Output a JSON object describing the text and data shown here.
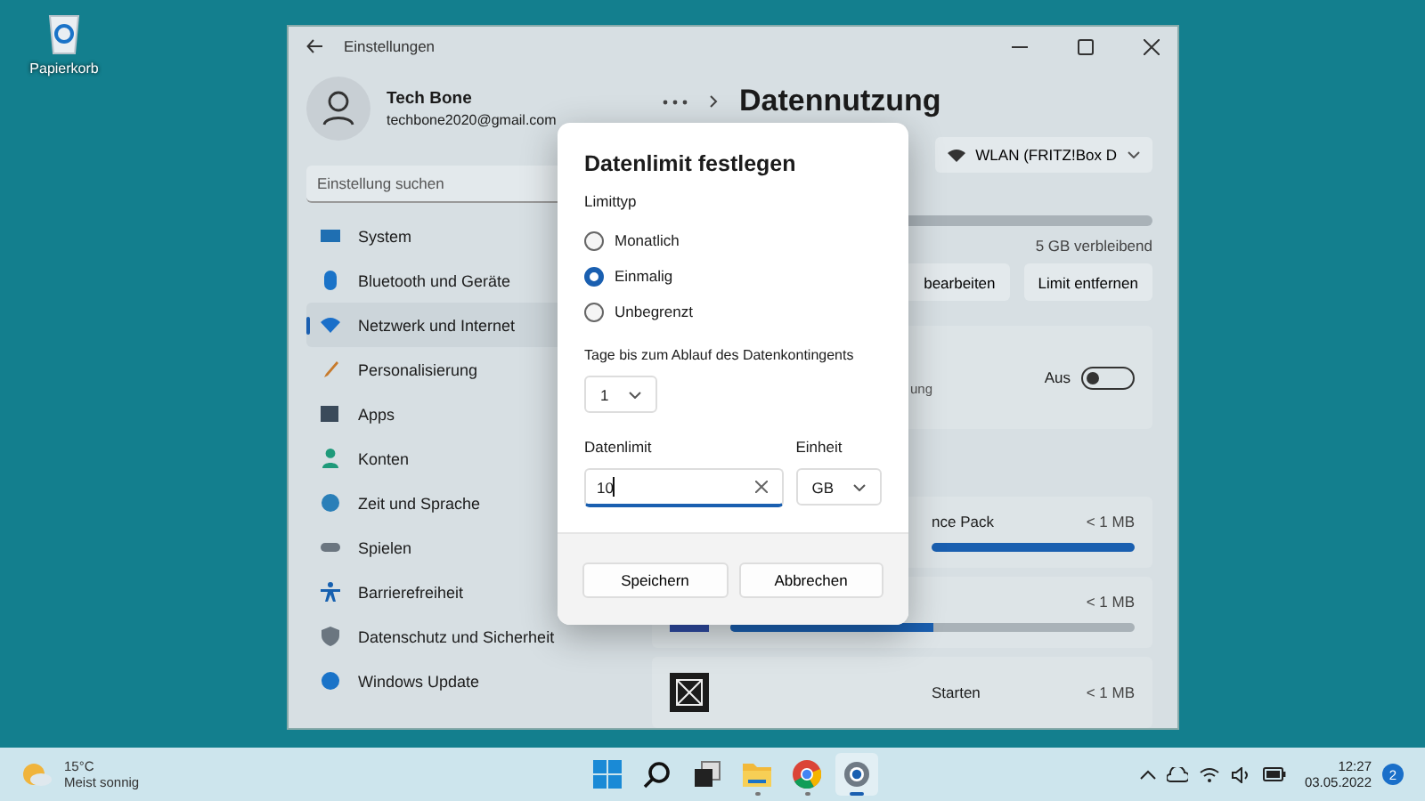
{
  "desktop_icons": [
    {
      "label": "Papierkorb"
    }
  ],
  "window": {
    "title": "Einstellungen",
    "profile": {
      "name": "Tech Bone",
      "email": "techbone2020@gmail.com"
    },
    "search": {
      "placeholder": "Einstellung suchen"
    },
    "nav": [
      {
        "label": "System",
        "selected": false
      },
      {
        "label": "Bluetooth und Geräte",
        "selected": false
      },
      {
        "label": "Netzwerk und Internet",
        "selected": true
      },
      {
        "label": "Personalisierung",
        "selected": false
      },
      {
        "label": "Apps",
        "selected": false
      },
      {
        "label": "Konten",
        "selected": false
      },
      {
        "label": "Zeit und Sprache",
        "selected": false
      },
      {
        "label": "Spielen",
        "selected": false
      },
      {
        "label": "Barrierefreiheit",
        "selected": false
      },
      {
        "label": "Datenschutz und Sicherheit",
        "selected": false
      },
      {
        "label": "Windows Update",
        "selected": false
      }
    ],
    "page_title": "Datennutzung",
    "network": "WLAN (FRITZ!Box D",
    "remaining": "5 GB verbleibend",
    "buttons": [
      "bearbeiten",
      "Limit entfernen"
    ],
    "setting_card": {
      "text": "ung",
      "toggle_label": "Aus",
      "on": false
    },
    "apps": [
      {
        "name": "nce Pack",
        "usage": "< 1 MB",
        "level": 1
      },
      {
        "usage": "< 1 MB",
        "level": 0.5
      },
      {
        "name": "Starten",
        "usage": "< 1 MB"
      }
    ]
  },
  "dialog": {
    "title": "Datenlimit festlegen",
    "limit_type_label": "Limittyp",
    "options": [
      {
        "label": "Monatlich",
        "selected": false
      },
      {
        "label": "Einmalig",
        "selected": true
      },
      {
        "label": "Unbegrenzt",
        "selected": false
      }
    ],
    "days_label": "Tage bis zum Ablauf des Datenkontingents",
    "days_value": "1",
    "limit_label": "Datenlimit",
    "limit_value": "10",
    "unit_label": "Einheit",
    "unit_value": "GB",
    "buttons": [
      "Speichern",
      "Abbrechen"
    ]
  },
  "taskbar": {
    "weather": {
      "temp": "15°C",
      "desc": "Meist sonnig"
    },
    "apps": [
      {
        "kind": "start",
        "active": false,
        "running": false
      },
      {
        "kind": "search",
        "active": false,
        "running": false
      },
      {
        "kind": "taskview",
        "active": false,
        "running": false
      },
      {
        "kind": "explorer",
        "active": false,
        "running": true
      },
      {
        "kind": "chrome",
        "active": false,
        "running": true
      },
      {
        "kind": "settings",
        "active": true,
        "running": true
      }
    ],
    "time": "12:27",
    "date": "03.05.2022",
    "notifications": "2"
  }
}
